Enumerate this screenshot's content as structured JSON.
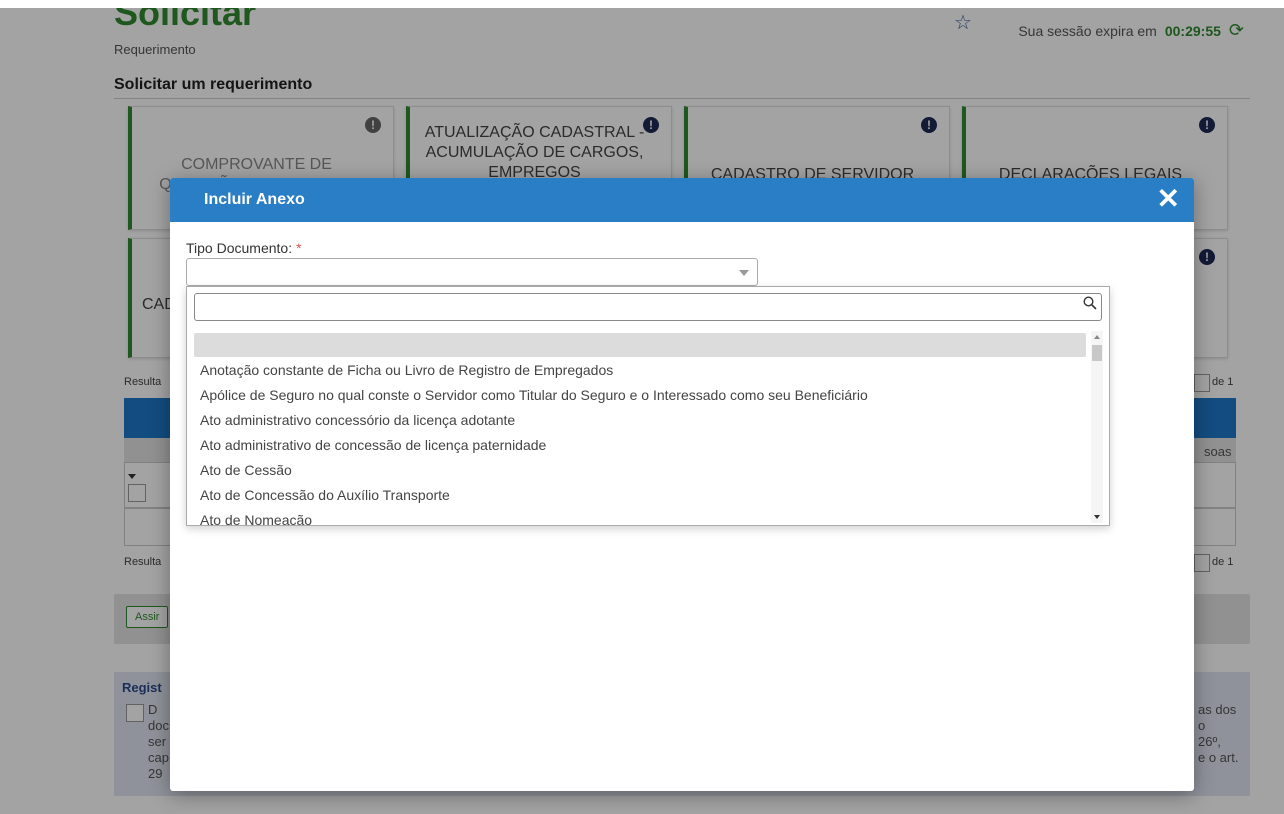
{
  "page": {
    "title": "Solicitar",
    "subtitle": "Requerimento",
    "section_title": "Solicitar um requerimento",
    "session_label": "Sua sessão expira em",
    "session_timer": "00:29:55",
    "cards": [
      "COMPROVANTE DE QUITAÇÃO DE PLANO DE",
      "ATUALIZAÇÃO CADASTRAL - ACUMULAÇÃO DE CARGOS, EMPREGOS",
      "CADASTRO DE SERVIDOR",
      "DECLARAÇÕES LEGAIS",
      "CAD"
    ],
    "result_label_top": "Resulta",
    "result_label_bottom": "Resulta",
    "pager_of_top": "de 1",
    "pager_of_bottom": "de 1",
    "column_fragment": "soas",
    "action_button": "Assir",
    "register_title": "Regist",
    "register_left_lines": [
      "D",
      "doc",
      "ser",
      "cap",
      "29"
    ],
    "register_right_lines": [
      "as dos",
      "o",
      "26º,",
      "e o art."
    ]
  },
  "modal": {
    "title": "Incluir Anexo",
    "close_icon": "close-icon",
    "field_label": "Tipo Documento:",
    "required_mark": "*",
    "selected_value": ""
  },
  "dropdown": {
    "search_value": "",
    "options": [
      "",
      "Anotação constante de Ficha ou Livro de Registro de Empregados",
      "Apólice de Seguro no qual conste o Servidor como Titular do Seguro e o Interessado como seu Beneficiário",
      "Ato administrativo concessório da licença adotante",
      "Ato administrativo de concessão de licença paternidade",
      "Ato de Cessão",
      "Ato de Concessão do Auxílio Transporte",
      "Ato de Nomeação"
    ]
  },
  "colors": {
    "brand_green": "#2f8a2f",
    "modal_header_blue": "#2a7ec6",
    "alert_navy": "#1e2a55"
  }
}
